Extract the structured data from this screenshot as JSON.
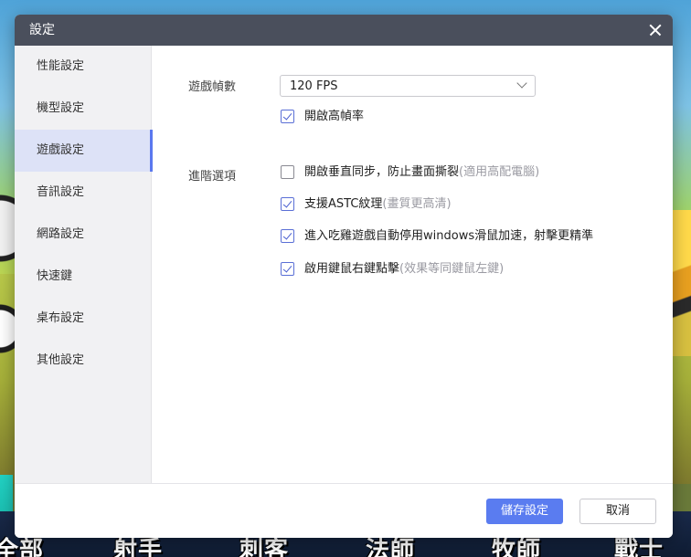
{
  "dialog": {
    "title": "設定"
  },
  "sidebar": {
    "items": [
      {
        "label": "性能設定"
      },
      {
        "label": "機型設定"
      },
      {
        "label": "遊戲設定"
      },
      {
        "label": "音訊設定"
      },
      {
        "label": "網路設定"
      },
      {
        "label": "快速鍵"
      },
      {
        "label": "桌布設定"
      },
      {
        "label": "其他設定"
      }
    ],
    "active_index": 2
  },
  "main": {
    "frame_rate": {
      "label": "遊戲幀數",
      "selected": "120 FPS",
      "high_frame_rate_label": "開啟高幀率",
      "high_frame_rate_checked": true
    },
    "advanced": {
      "label": "進階選項",
      "options": [
        {
          "text": "開啟垂直同步，防止畫面撕裂",
          "note": "(適用高配電腦)",
          "checked": false
        },
        {
          "text": "支援ASTC紋理",
          "note": "(畫質更高清)",
          "checked": true
        },
        {
          "text": "進入吃雞遊戲自動停用windows滑鼠加速，射擊更精準",
          "note": "",
          "checked": true
        },
        {
          "text": "啟用鍵鼠右鍵點擊",
          "note": "(效果等同鍵鼠左鍵)",
          "checked": true
        }
      ]
    }
  },
  "footer": {
    "save_label": "儲存設定",
    "cancel_label": "取消"
  },
  "background": {
    "labels": [
      "全部",
      "射手",
      "刺客",
      "法師",
      "牧師",
      "戰士"
    ]
  }
}
